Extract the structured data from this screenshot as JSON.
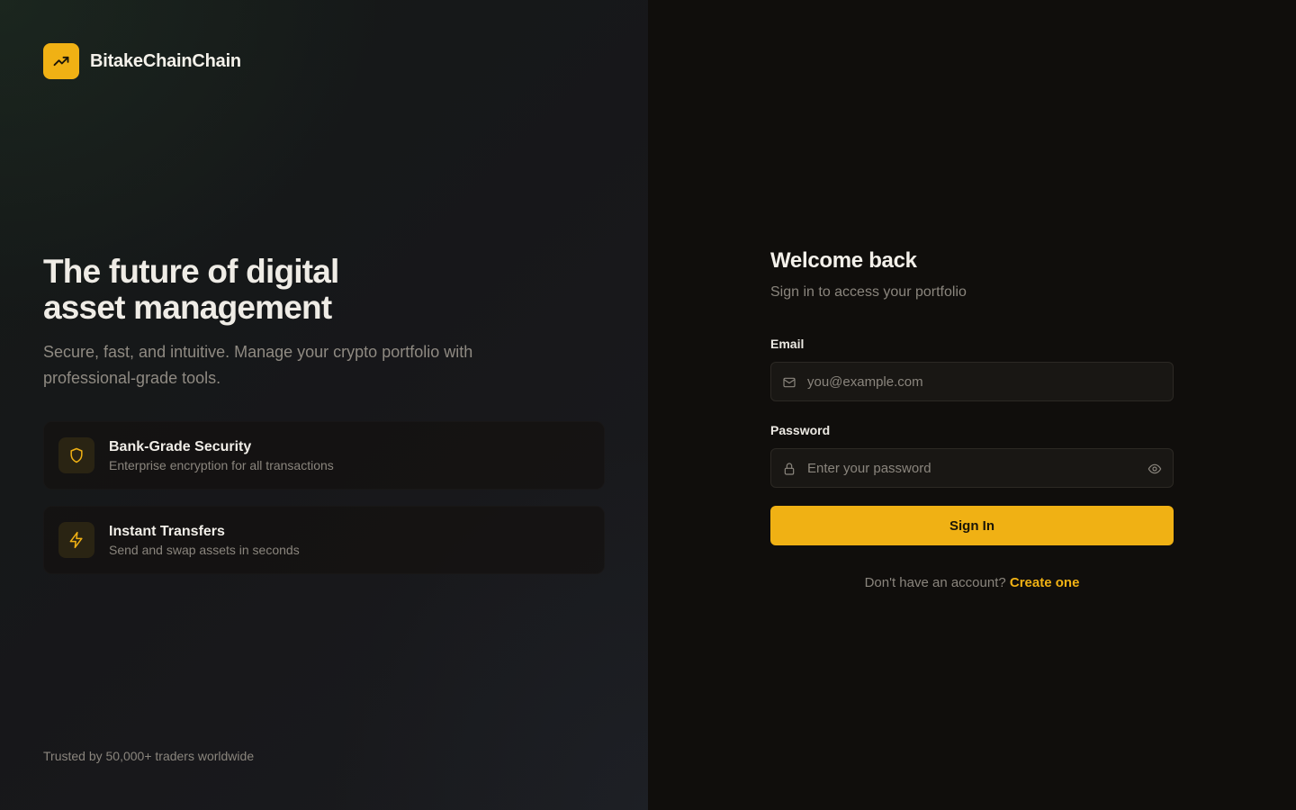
{
  "brand": {
    "name": "BitakeChainChain",
    "logo_icon": "trending-up-icon"
  },
  "hero": {
    "title": "The future of digital asset management",
    "subtitle": "Secure, fast, and intuitive. Manage your crypto portfolio with professional-grade tools."
  },
  "features": [
    {
      "icon": "shield-icon",
      "title": "Bank-Grade Security",
      "description": "Enterprise encryption for all transactions"
    },
    {
      "icon": "lightning-icon",
      "title": "Instant Transfers",
      "description": "Send and swap assets in seconds"
    }
  ],
  "trust_text": "Trusted by 50,000+ traders worldwide",
  "form": {
    "title": "Welcome back",
    "subtitle": "Sign in to access your portfolio",
    "email_label": "Email",
    "email_placeholder": "you@example.com",
    "email_value": "",
    "password_label": "Password",
    "password_placeholder": "Enter your password",
    "password_value": "",
    "submit_label": "Sign In",
    "signup_prompt": "Don't have an account?",
    "signup_link": "Create one"
  },
  "colors": {
    "accent": "#f0b114",
    "background": "#100e0c",
    "muted_text": "#8a857d"
  }
}
